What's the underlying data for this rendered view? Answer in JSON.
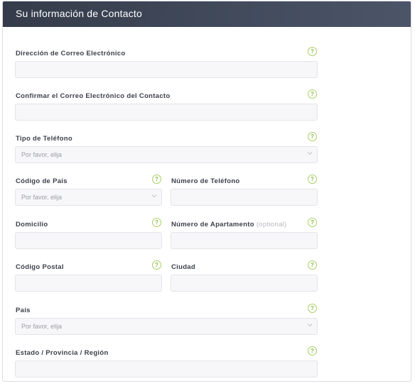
{
  "header": {
    "title": "Su información de Contacto"
  },
  "help_glyph": "?",
  "fields": {
    "email": {
      "label": "Dirección de Correo Electrónico"
    },
    "email_confirm": {
      "label": "Confirmar el Correo Electrónico del Contacto"
    },
    "phone_type": {
      "label": "Tipo de Teléfono",
      "value": "Por favor, elija"
    },
    "country_code": {
      "label": "Código de País",
      "value": "Por favor, elija"
    },
    "phone_number": {
      "label": "Número de Teléfono"
    },
    "address": {
      "label": "Domicilio"
    },
    "apartment": {
      "label": "Número de Apartamento",
      "optional": "(optional)"
    },
    "postal_code": {
      "label": "Código Postal"
    },
    "city": {
      "label": "Ciudad"
    },
    "country": {
      "label": "País",
      "value": "Por favor, elija"
    },
    "state": {
      "label": "Estado / Provincia / Región"
    }
  },
  "colors": {
    "header_start": "#343c4b",
    "header_end": "#4c5568",
    "help_icon": "#8dbb44",
    "input_bg": "#f7f7f9"
  }
}
